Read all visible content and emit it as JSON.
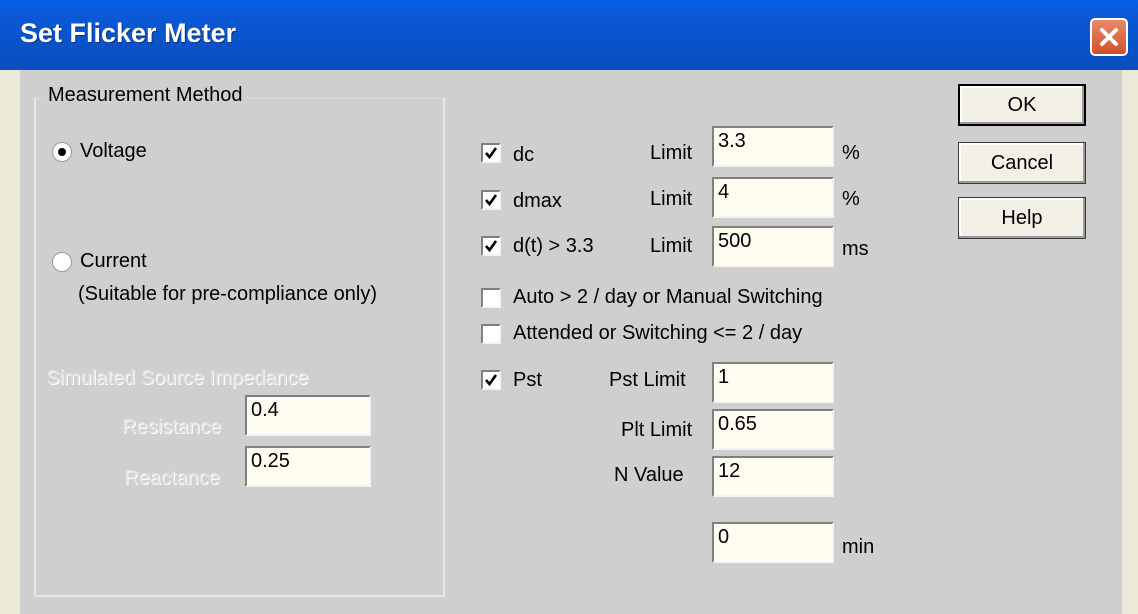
{
  "window": {
    "title": "Set Flicker Meter",
    "close_icon": "close-icon"
  },
  "measurement_method": {
    "legend": "Measurement Method",
    "voltage": {
      "label": "Voltage",
      "selected": true
    },
    "current": {
      "label": "Current",
      "note": "(Suitable for pre-compliance only)",
      "selected": false
    }
  },
  "source_impedance": {
    "title": "Simulated Source Impedance",
    "resistance_label": "Resistance",
    "resistance_value": "0.4",
    "reactance_label": "Reactance",
    "reactance_value": "0.25"
  },
  "limits": {
    "dc": {
      "label": "dc",
      "checked": true,
      "limit_label": "Limit",
      "value": "3.3",
      "unit": "%"
    },
    "dmax": {
      "label": "dmax",
      "checked": true,
      "limit_label": "Limit",
      "value": "4",
      "unit": "%"
    },
    "dt": {
      "label": "d(t) > 3.3",
      "checked": true,
      "limit_label": "Limit",
      "value": "500",
      "unit": "ms"
    }
  },
  "switching": {
    "auto": {
      "label": "Auto > 2 / day or Manual Switching",
      "checked": false
    },
    "attended": {
      "label": "Attended or Switching <= 2 / day",
      "checked": false
    }
  },
  "pst": {
    "label": "Pst",
    "checked": true,
    "pst_limit_label": "Pst Limit",
    "pst_limit_value": "1",
    "plt_limit_label": "Plt Limit",
    "plt_limit_value": "0.65",
    "n_value_label": "N Value",
    "n_value": "12",
    "time_value": "0",
    "time_unit": "min"
  },
  "buttons": {
    "ok": "OK",
    "cancel": "Cancel",
    "help": "Help"
  },
  "colors": {
    "titlebar": "#0853c8",
    "dialog_bg": "#cfcfcf",
    "field_bg": "#fffdef",
    "close_button": "#d1502e"
  }
}
